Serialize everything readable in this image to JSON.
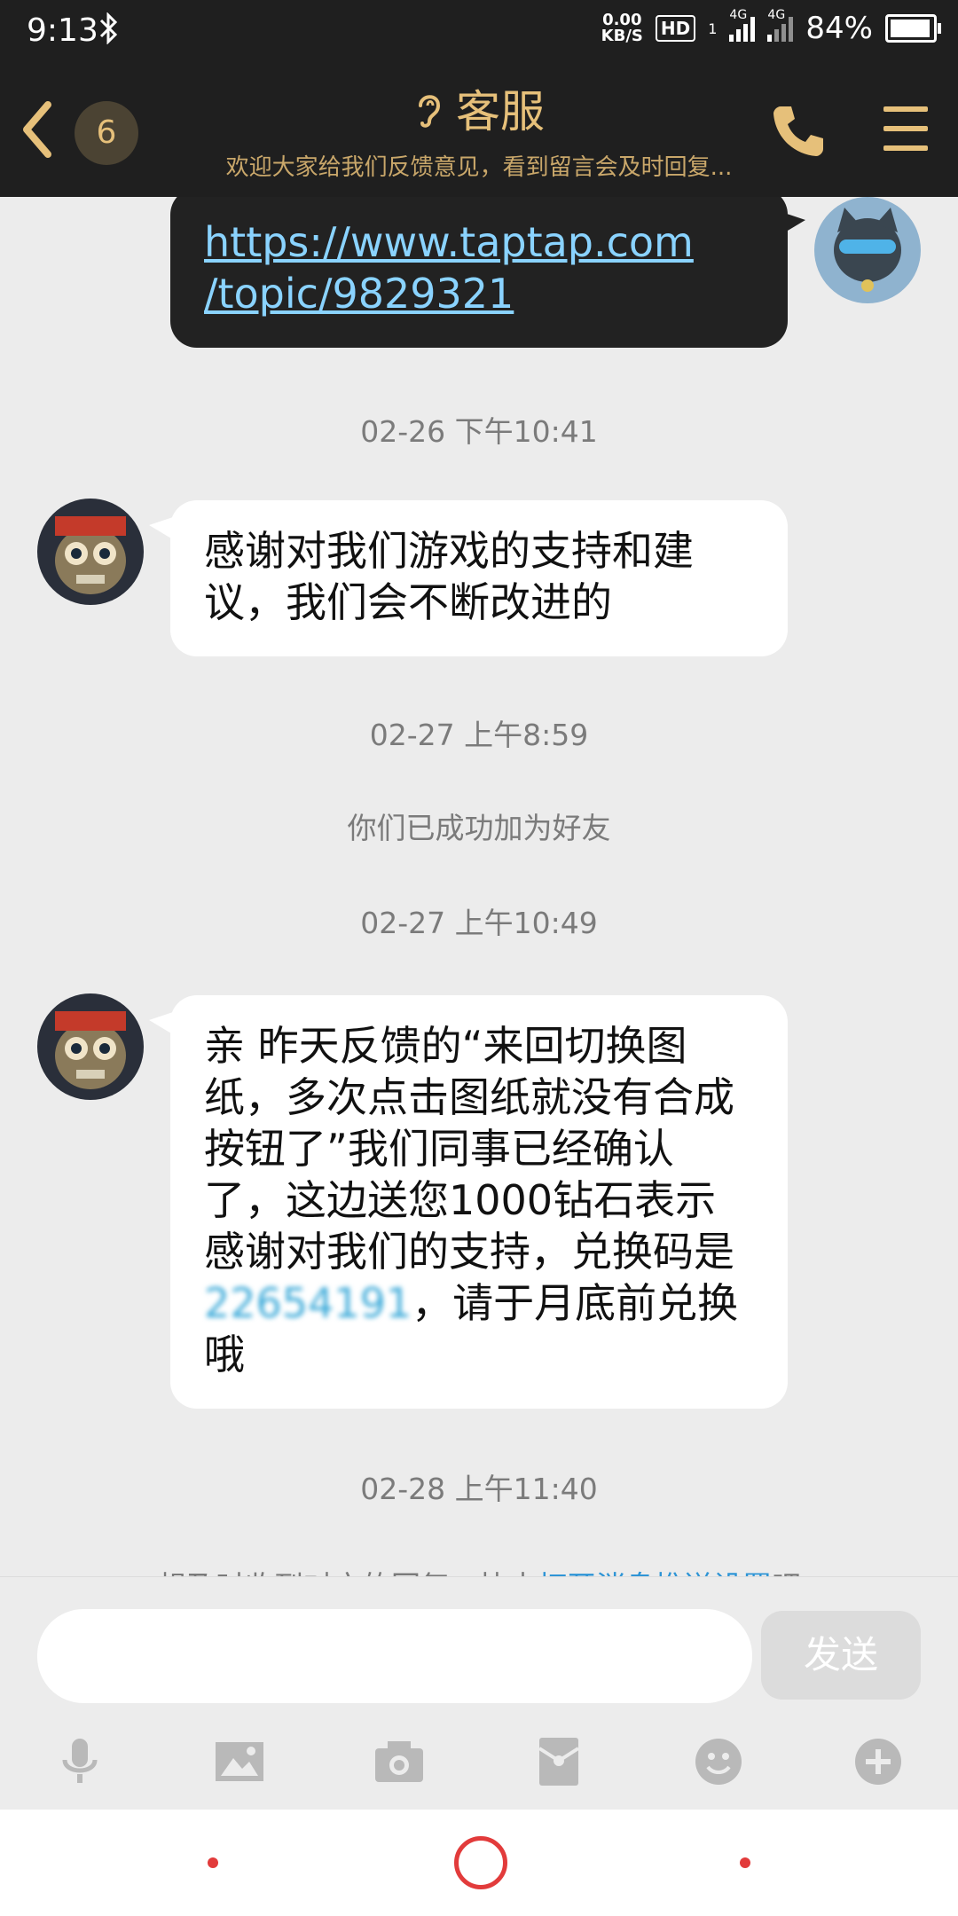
{
  "status_bar": {
    "time": "9:13",
    "speed_value": "0.00",
    "speed_unit": "KB/S",
    "hd": "HD",
    "sim1": "1",
    "net1": "4G",
    "net2": "4G",
    "battery": "84%"
  },
  "header": {
    "unread_count": "6",
    "title": "客服",
    "subtitle": "欢迎大家给我们反馈意见，看到留言会及时回复..."
  },
  "messages": {
    "m1_link_line1": "https://www.taptap.com",
    "m1_link_line2": "/topic/9829321",
    "ts1": "02-26 下午10:41",
    "m2_text": "感谢对我们游戏的支持和建议，我们会不断改进的",
    "ts2": "02-27 上午8:59",
    "sys1": "你们已成功加为好友",
    "ts3": "02-27 上午10:49",
    "m3_part1": "亲 昨天反馈的“来回切换图纸，多次点击图纸就没有合成按钮了”我们同事已经确认了，这边送您1000钻石表示感谢对我们的支持，兑换码是",
    "m3_code": "22654191",
    "m3_part2": "，请于月底前兑换哦",
    "ts4": "02-28 上午11:40",
    "hint_prefix": "想及时收到对方的回复，快去",
    "hint_link": "打开消息推送设置",
    "hint_suffix": "吧"
  },
  "composer": {
    "input_value": "",
    "send_label": "发送"
  },
  "icons": [
    "back-icon",
    "ear-icon",
    "phone-icon",
    "menu-icon",
    "microphone-icon",
    "image-icon",
    "camera-icon",
    "red-packet-icon",
    "emoji-icon",
    "plus-icon"
  ],
  "colors": {
    "header_bg": "#1f1f1f",
    "accent_gold": "#e6c07a",
    "chat_bg": "#ececec",
    "link_blue": "#2f95d6"
  }
}
